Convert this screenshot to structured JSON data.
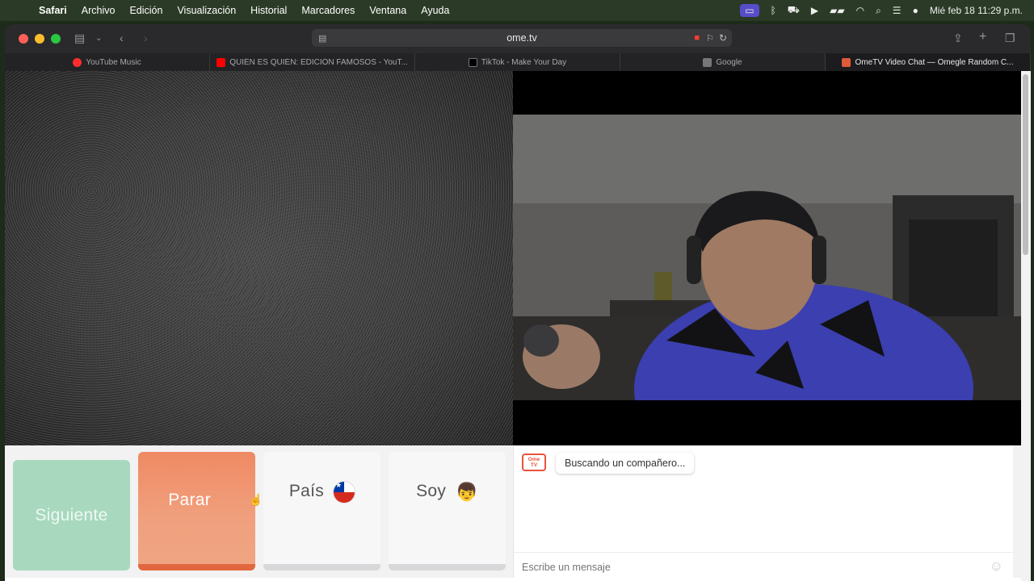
{
  "menubar": {
    "app_name": "Safari",
    "items": [
      "Archivo",
      "Edición",
      "Visualización",
      "Historial",
      "Marcadores",
      "Ventana",
      "Ayuda"
    ],
    "clock": "Mié feb 18  11:29 p.m."
  },
  "browser": {
    "url": "ome.tv",
    "tabs": [
      {
        "title": "YouTube Music",
        "favicon": "youtube-music-icon",
        "active": false
      },
      {
        "title": "QUIÉN ES QUIÉN: EDICIÓN FAMOSOS - YouT...",
        "favicon": "youtube-icon",
        "active": false
      },
      {
        "title": "TikTok - Make Your Day",
        "favicon": "tiktok-icon",
        "active": false
      },
      {
        "title": "Google",
        "favicon": "google-icon",
        "active": false
      },
      {
        "title": "OmeTV Video Chat — Omegle Random C...",
        "favicon": "ometv-icon",
        "active": true
      }
    ]
  },
  "controls": {
    "next_label": "Siguiente",
    "stop_label": "Parar",
    "country_label": "País",
    "iam_label": "Soy",
    "country_flag": "chile-flag-icon",
    "iam_emoji": "boy-face-icon"
  },
  "chat": {
    "logo_line1": "Ome",
    "logo_line2": "TV",
    "status_message": "Buscando un compañero...",
    "input_placeholder": "Escribe un mensaje"
  },
  "colors": {
    "next_button": "#a8d9bf",
    "stop_button": "#ef8a63",
    "accent": "#e8533b"
  }
}
